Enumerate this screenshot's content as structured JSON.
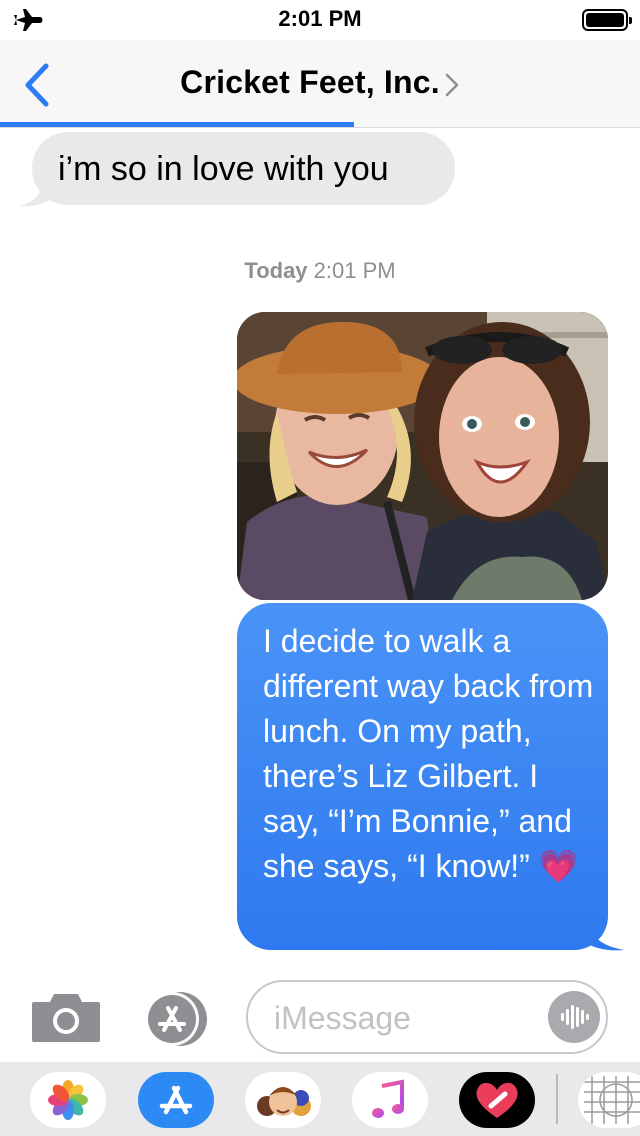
{
  "status_bar": {
    "time": "2:01 PM",
    "airplane_icon": "airplane-icon",
    "battery_icon": "battery-icon"
  },
  "nav": {
    "title": "Cricket Feet, Inc.",
    "back_icon": "chevron-left-icon",
    "details_icon": "chevron-right-icon",
    "accent": "#2e7bf6"
  },
  "messages": [
    {
      "direction": "incoming",
      "text": "i’m so in love with you"
    },
    {
      "direction": "timestamp",
      "day": "Today",
      "time": "2:01 PM"
    },
    {
      "direction": "outgoing",
      "type": "photo"
    },
    {
      "direction": "outgoing",
      "text": "I decide to walk a different way back from lunch. On my path, there’s Liz Gilbert. I say, “I’m Bonnie,” and she says, “I know!”",
      "emoji": "💗"
    }
  ],
  "composer": {
    "placeholder": "iMessage",
    "camera_icon": "camera-icon",
    "apps_icon": "app-store-icon",
    "audio_icon": "waveform-icon"
  },
  "app_drawer": {
    "apps": [
      "photos-icon",
      "app-store-icon",
      "memoji-icon",
      "music-icon",
      "digital-touch-icon",
      "grid-app-icon"
    ]
  },
  "colors": {
    "outgoing_bubble": "#3a86f3",
    "incoming_bubble": "#e9e9eb",
    "timestamp": "#8e8e93"
  }
}
